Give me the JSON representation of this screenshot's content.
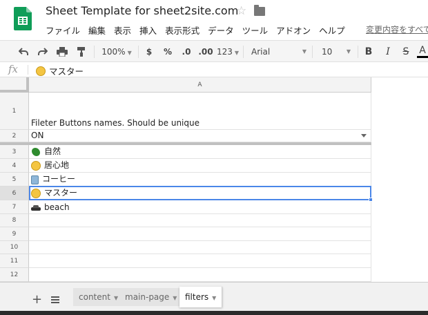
{
  "doc": {
    "title": "Sheet Template for sheet2site.com",
    "changes_link": "変更内容をすべて"
  },
  "menu": [
    "ファイル",
    "編集",
    "表示",
    "挿入",
    "表示形式",
    "データ",
    "ツール",
    "アドオン",
    "ヘルプ"
  ],
  "toolbar": {
    "zoom": "100%",
    "currency": "$",
    "percent": "%",
    "dec_less": ".0",
    "dec_more": ".00",
    "format_more": "123",
    "font": "Arial",
    "font_size": "10",
    "bold": "B",
    "italic": "I",
    "strike": "S",
    "text_color": "A"
  },
  "formula": {
    "fx": "fx",
    "value": "マスター"
  },
  "grid": {
    "column": "A",
    "rows": [
      {
        "num": "1",
        "text": "Fileter Buttons names. Should be unique",
        "icon": ""
      },
      {
        "num": "2",
        "text": "ON",
        "icon": ""
      },
      {
        "num": "3",
        "text": "自然",
        "icon": "clover"
      },
      {
        "num": "4",
        "text": "居心地",
        "icon": "face"
      },
      {
        "num": "5",
        "text": "コーヒー",
        "icon": "cup"
      },
      {
        "num": "6",
        "text": "マスター",
        "icon": "face"
      },
      {
        "num": "7",
        "text": "beach",
        "icon": "car"
      },
      {
        "num": "8",
        "text": "",
        "icon": ""
      },
      {
        "num": "9",
        "text": "",
        "icon": ""
      },
      {
        "num": "10",
        "text": "",
        "icon": ""
      },
      {
        "num": "11",
        "text": "",
        "icon": ""
      },
      {
        "num": "12",
        "text": "",
        "icon": ""
      }
    ]
  },
  "sheets": {
    "tabs": [
      "content",
      "main-page",
      "filters"
    ],
    "active": "filters",
    "add": "+"
  },
  "colors": {
    "selection": "#4a86e8",
    "logo_green": "#0f9d58"
  }
}
